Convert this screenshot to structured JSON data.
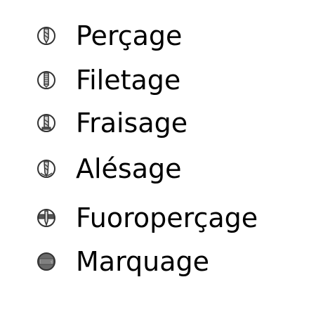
{
  "items": [
    {
      "label": "Perçage",
      "icon": "drill-icon"
    },
    {
      "label": "Filetage",
      "icon": "tap-thread-icon"
    },
    {
      "label": "Fraisage",
      "icon": "end-mill-icon"
    },
    {
      "label": "Alésage",
      "icon": "reamer-icon"
    },
    {
      "label": "Fuoroperçage",
      "icon": "flowdrill-icon"
    },
    {
      "label": "Marquage",
      "icon": "marking-icon"
    }
  ],
  "colors": {
    "text": "#000000",
    "icon_stroke": "#333333",
    "icon_fill": "#d0d0d0",
    "icon_dark": "#555555"
  }
}
